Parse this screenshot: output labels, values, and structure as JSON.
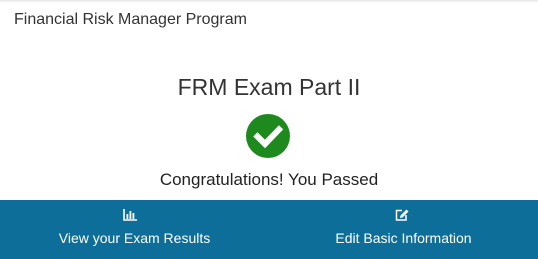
{
  "header": {
    "program_title": "Financial Risk Manager Program"
  },
  "main": {
    "exam_title": "FRM Exam Part II",
    "status_icon": "check-circle-icon",
    "status_text": "Congratulations! You Passed",
    "status_color": "#1e8a1e"
  },
  "actions": {
    "bar_color": "#0d6e9a",
    "items": [
      {
        "label": "View your Exam Results",
        "icon": "bar-chart-icon"
      },
      {
        "label": "Edit Basic Information",
        "icon": "edit-icon"
      }
    ]
  }
}
